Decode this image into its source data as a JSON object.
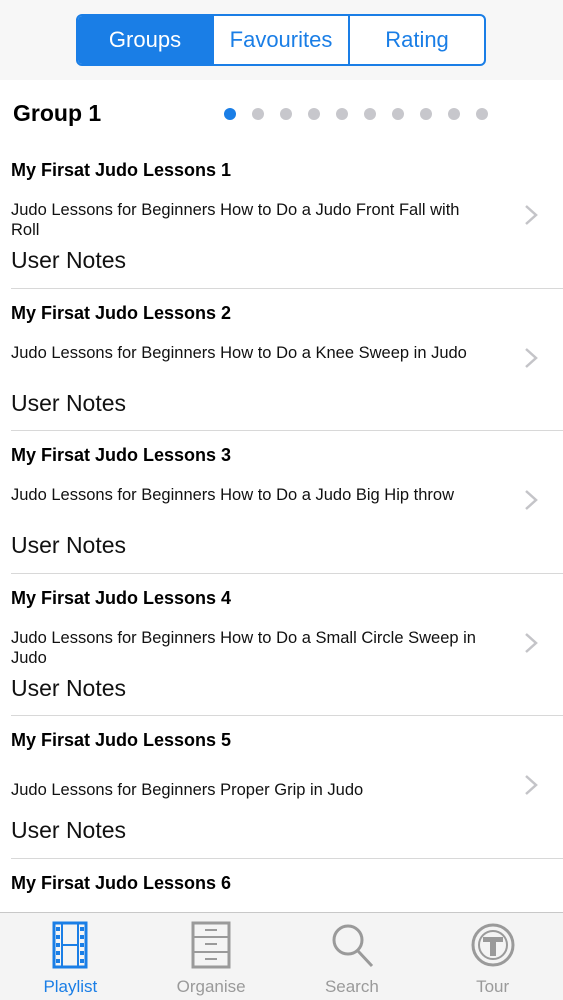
{
  "segments": [
    "Groups",
    "Favourites",
    "Rating"
  ],
  "group": {
    "title": "Group 1"
  },
  "page_indicator": {
    "count": 10,
    "active_index": 0
  },
  "lessons": [
    {
      "title": "My Firsat Judo Lessons 1",
      "description": "Judo Lessons for Beginners  How to Do a Judo Front Fall with Roll",
      "notes": "User Notes"
    },
    {
      "title": "My Firsat Judo Lessons 2",
      "description": "Judo Lessons for Beginners  How to Do a Knee Sweep in Judo",
      "notes": "User Notes"
    },
    {
      "title": "My Firsat Judo Lessons 3",
      "description": "Judo Lessons for Beginners  How to Do a Judo Big Hip throw",
      "notes": "User Notes"
    },
    {
      "title": "My Firsat Judo Lessons 4",
      "description": "Judo Lessons for Beginners  How to Do a Small Circle Sweep in Judo",
      "notes": "User Notes"
    },
    {
      "title": "My Firsat Judo Lessons 5",
      "description": "Judo Lessons for Beginners  Proper Grip in Judo",
      "notes": "User Notes"
    },
    {
      "title": "My Firsat Judo Lessons 6",
      "description": "",
      "notes": ""
    }
  ],
  "tabs": [
    {
      "label": "Playlist",
      "icon": "film-strip-icon",
      "active": true
    },
    {
      "label": "Organise",
      "icon": "filing-cabinet-icon",
      "active": false
    },
    {
      "label": "Search",
      "icon": "magnifier-icon",
      "active": false
    },
    {
      "label": "Tour",
      "icon": "tour-sign-icon",
      "active": false
    }
  ],
  "colors": {
    "accent": "#1a7ee6",
    "inactive": "#9a9a9a",
    "dot": "#c7c7cc"
  }
}
